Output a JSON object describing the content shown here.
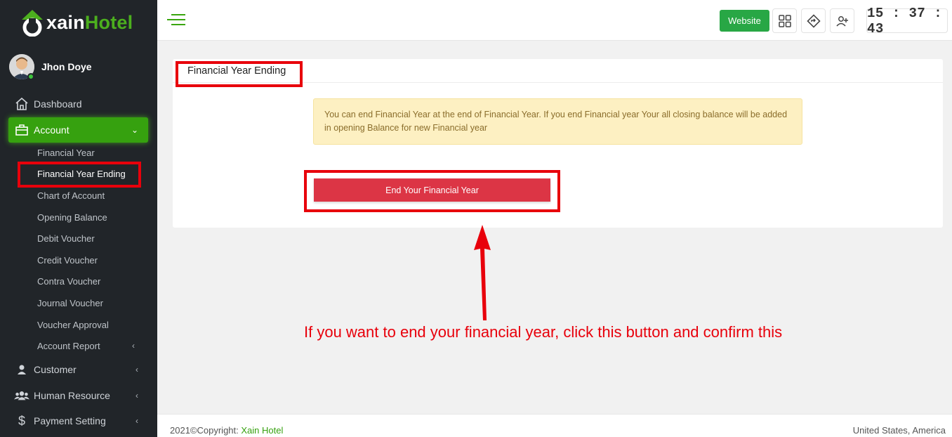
{
  "brand": {
    "name_part1": "xain",
    "name_part2": "Hotel",
    "accent": "#4caf1e"
  },
  "user": {
    "name": "Jhon Doye",
    "status": "online"
  },
  "sidebar": {
    "items": [
      {
        "label": "Dashboard",
        "icon": "home-icon"
      },
      {
        "label": "Account",
        "icon": "briefcase-icon",
        "active": true
      },
      {
        "label": "Customer",
        "icon": "user-icon"
      },
      {
        "label": "Human Resource",
        "icon": "users-icon"
      },
      {
        "label": "Payment Setting",
        "icon": "dollar-icon"
      }
    ],
    "account_sub": [
      "Financial Year",
      "Financial Year Ending",
      "Chart of Account",
      "Opening Balance",
      "Debit Voucher",
      "Credit Voucher",
      "Contra Voucher",
      "Journal Voucher",
      "Voucher Approval",
      "Account Report"
    ]
  },
  "topbar": {
    "website_label": "Website",
    "clock": "15 : 37 : 43"
  },
  "main": {
    "card_title": "Financial Year Ending",
    "alert_text": "You can end Financial Year at the end of Financial Year. If you end Financial year Your all closing balance will be added in opening Balance for new Financial year",
    "end_button_label": "End Your Financial Year"
  },
  "annotation": {
    "text": "If you want to end your financial year, click this button and confirm this",
    "color": "#e8000b"
  },
  "footer": {
    "copyright_prefix": "2021©Copyright: ",
    "copyright_brand": "Xain Hotel",
    "locale": "United States, America"
  }
}
